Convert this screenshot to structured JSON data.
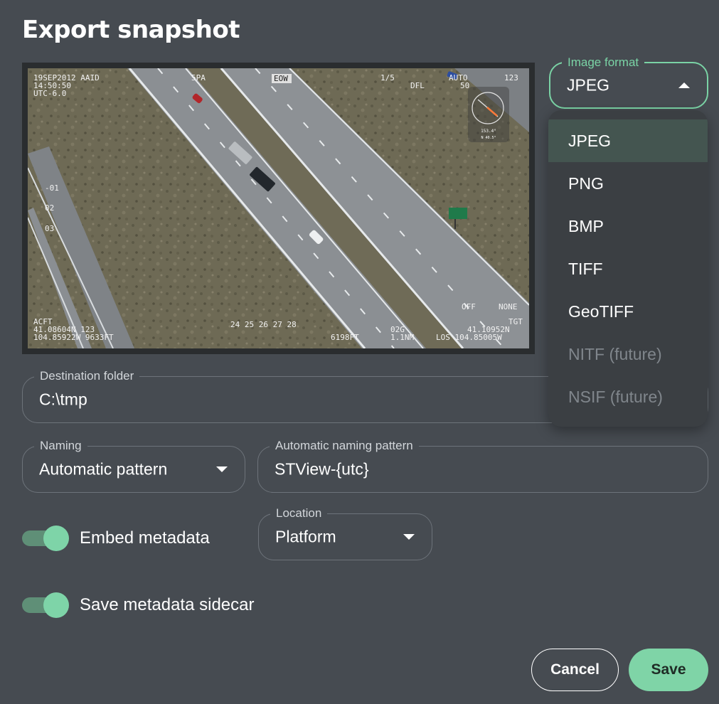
{
  "dialog": {
    "title": "Export snapshot"
  },
  "preview": {
    "overlay": {
      "top_left": [
        "19SEP2012  AAID",
        "14:50:50",
        "UTC-6.0"
      ],
      "top_mid": "5PA",
      "top_mode": "EOW",
      "top_right_a": "1/5",
      "top_right_b": "AUTO",
      "top_right_c": "DFL",
      "top_right_d": "123",
      "top_right_e": "50",
      "left_ticks": [
        "-01",
        "02",
        "03"
      ],
      "compass_heading": "153.4°",
      "compass_sub": "N 40.5°",
      "bottom_left": [
        "ACFT",
        "41.08604N   123",
        "104.85922W  9633FT"
      ],
      "scale_ticks": "24  25  26  27  28",
      "bottom_mid": "6198FT",
      "bottom_mid2_a": "02G",
      "bottom_mid2_b": "1.1NM",
      "bottom_right_off": "OFF",
      "bottom_right_none": "NONE",
      "bottom_right_tgt": "TGT",
      "bottom_right_a": "41.10952N",
      "bottom_right_b": "LOS 104.85005W"
    }
  },
  "image_format": {
    "label": "Image format",
    "value": "JPEG",
    "options": [
      {
        "label": "JPEG",
        "state": "selected"
      },
      {
        "label": "PNG",
        "state": "enabled"
      },
      {
        "label": "BMP",
        "state": "enabled"
      },
      {
        "label": "TIFF",
        "state": "enabled"
      },
      {
        "label": "GeoTIFF",
        "state": "enabled"
      },
      {
        "label": "NITF (future)",
        "state": "disabled"
      },
      {
        "label": "NSIF (future)",
        "state": "disabled"
      }
    ]
  },
  "destination": {
    "label": "Destination folder",
    "value": "C:\\tmp"
  },
  "naming": {
    "label": "Naming",
    "value": "Automatic pattern"
  },
  "pattern": {
    "label": "Automatic naming pattern",
    "value": "STView-{utc}"
  },
  "embed": {
    "label": "Embed metadata",
    "on": true
  },
  "location": {
    "label": "Location",
    "value": "Platform"
  },
  "sidecar": {
    "label": "Save metadata sidecar",
    "on": true
  },
  "buttons": {
    "cancel": "Cancel",
    "save": "Save"
  },
  "colors": {
    "accent": "#7ad3a5",
    "background": "#464b51",
    "menu": "#3b3f43"
  }
}
